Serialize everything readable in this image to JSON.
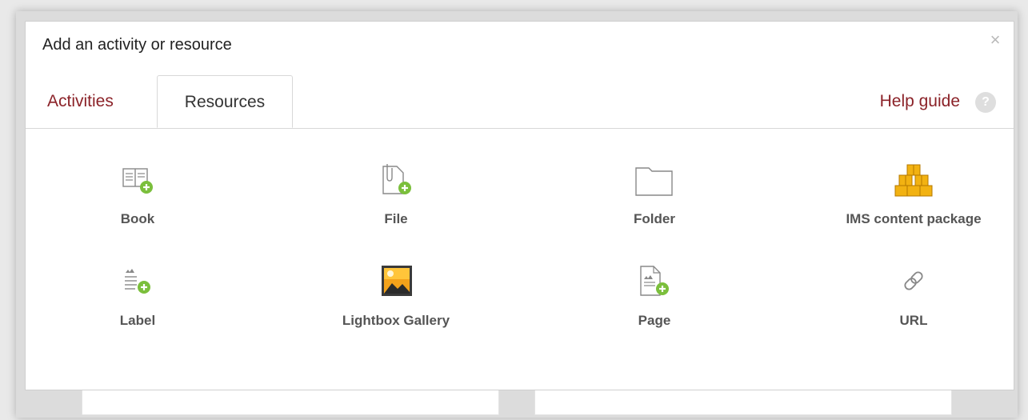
{
  "modal": {
    "title": "Add an activity or resource",
    "close_label": "×"
  },
  "tabs": [
    {
      "label": "Activities",
      "active": false
    },
    {
      "label": "Resources",
      "active": true
    }
  ],
  "help": {
    "label": "Help guide",
    "icon_text": "?"
  },
  "resources": [
    {
      "label": "Book",
      "icon": "book-add-icon"
    },
    {
      "label": "File",
      "icon": "file-add-icon"
    },
    {
      "label": "Folder",
      "icon": "folder-icon"
    },
    {
      "label": "IMS content package",
      "icon": "ims-package-icon"
    },
    {
      "label": "Label",
      "icon": "label-add-icon"
    },
    {
      "label": "Lightbox Gallery",
      "icon": "lightbox-gallery-icon"
    },
    {
      "label": "Page",
      "icon": "page-add-icon"
    },
    {
      "label": "URL",
      "icon": "link-icon"
    }
  ],
  "colors": {
    "tab_link": "#8b2228",
    "add_badge": "#7bbf3c",
    "label_text": "#555555"
  }
}
